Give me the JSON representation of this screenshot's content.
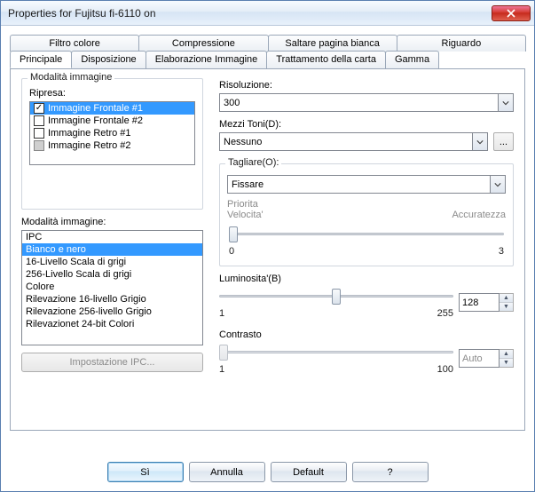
{
  "window": {
    "title": "Properties for Fujitsu fi-6110 on"
  },
  "tabs_top": [
    "Filtro colore",
    "Compressione",
    "Saltare pagina bianca",
    "Riguardo"
  ],
  "tabs_bot": [
    "Principale",
    "Disposizione",
    "Elaborazione Immagine",
    "Trattamento della carta",
    "Gamma"
  ],
  "active_tab": "Principale",
  "left": {
    "group_label": "Modalità immagine",
    "ripresa_label": "Ripresa:",
    "ripresa_items": [
      {
        "label": "Immagine Frontale #1",
        "checked": true,
        "selected": true,
        "disabled": false
      },
      {
        "label": "Immagine Frontale #2",
        "checked": false,
        "selected": false,
        "disabled": false
      },
      {
        "label": "Immagine Retro #1",
        "checked": false,
        "selected": false,
        "disabled": false
      },
      {
        "label": "Immagine Retro #2",
        "checked": false,
        "selected": false,
        "disabled": true
      }
    ],
    "mode_label": "Modalità immagine:",
    "mode_items": [
      {
        "label": "IPC",
        "selected": false
      },
      {
        "label": "Bianco e nero",
        "selected": true
      },
      {
        "label": "16-Livello Scala di grigi",
        "selected": false
      },
      {
        "label": "256-Livello Scala di grigi",
        "selected": false
      },
      {
        "label": "Colore",
        "selected": false
      },
      {
        "label": "Rilevazione 16-livello Grigio",
        "selected": false
      },
      {
        "label": "Rilevazione 256-livello Grigio",
        "selected": false
      },
      {
        "label": "Rilevazionet 24-bit Colori",
        "selected": false
      }
    ],
    "ipc_button": "Impostazione IPC..."
  },
  "right": {
    "resolution_label": "Risoluzione:",
    "resolution_value": "300",
    "halftone_label": "Mezzi Toni(D):",
    "halftone_value": "Nessuno",
    "dots_label": "...",
    "cut_group": "Tagliare(O):",
    "cut_value": "Fissare",
    "priority_label": "Priorita",
    "priority_left": "Velocita'",
    "priority_right": "Accuratezza",
    "priority_min": "0",
    "priority_max": "3",
    "brightness_label": "Luminosita'(B)",
    "brightness_value": "128",
    "brightness_min": "1",
    "brightness_max": "255",
    "contrast_label": "Contrasto",
    "contrast_value": "Auto",
    "contrast_min": "1",
    "contrast_max": "100"
  },
  "footer": {
    "ok": "Sì",
    "cancel": "Annulla",
    "default": "Default",
    "help": "?"
  }
}
